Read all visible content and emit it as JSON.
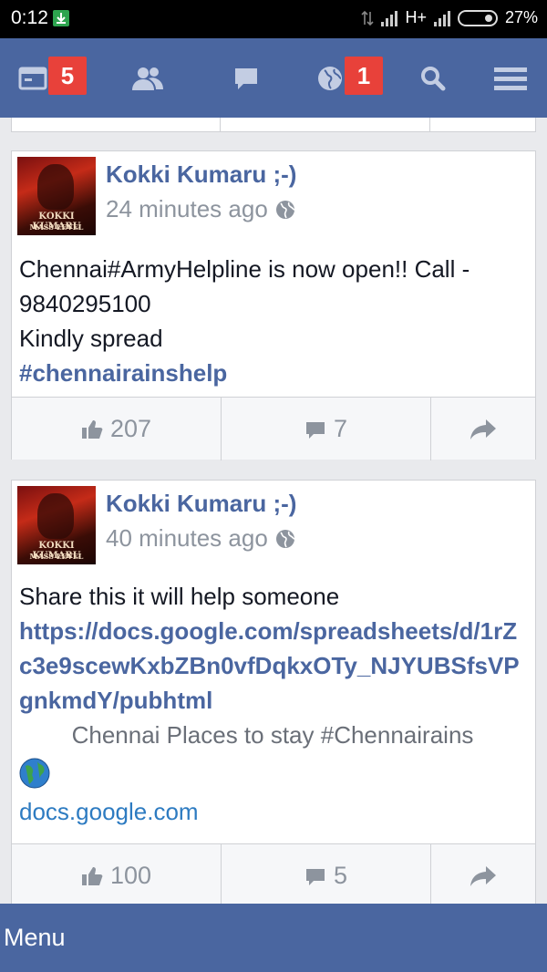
{
  "status_bar": {
    "time": "0:12",
    "network": "H+",
    "battery": "27%"
  },
  "nav": {
    "feed_badge": "5",
    "notifications_badge": "1"
  },
  "posts": [
    {
      "author": "Kokki Kumaru ;-)",
      "time": "24 minutes ago",
      "avatar_text": [
        "KOKKI KUMARU",
        "MASS LEVEL"
      ],
      "lines": [
        "Chennai#ArmyHelpline is now open!! Call -",
        "9840295100",
        "Kindly spread"
      ],
      "hashtag": "#chennairainshelp",
      "likes": "207",
      "comments": "7"
    },
    {
      "author": "Kokki Kumaru ;-)",
      "time": "40 minutes ago",
      "avatar_text": [
        "KOKKI KUMARU",
        "MASS LEVEL"
      ],
      "text": "Share this it will help someone",
      "link": "https://docs.google.com/spreadsheets/d/1rZc3e9scewKxbZBn0vfDqkxOTy_NJYUBSfsVPgnkmdY/pubhtml",
      "preview_title": "Chennai Places to stay #Chennairains",
      "preview_domain": "docs.google.com",
      "likes": "100",
      "comments": "5"
    }
  ],
  "bottom_bar": {
    "label": "Menu"
  }
}
